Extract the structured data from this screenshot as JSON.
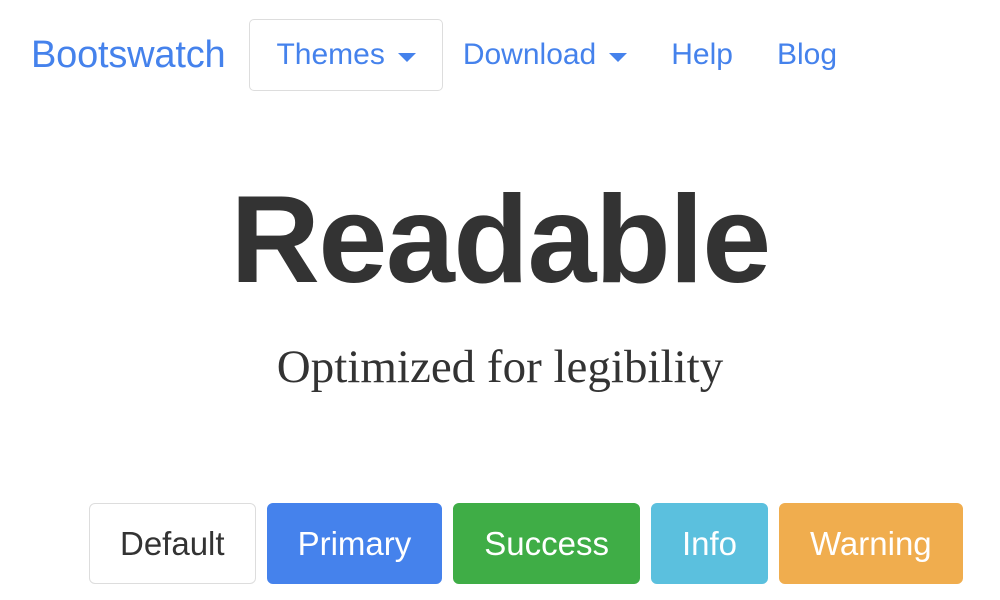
{
  "navbar": {
    "brand": "Bootswatch",
    "items": [
      {
        "label": "Themes",
        "has_caret": true,
        "style": "boxed"
      },
      {
        "label": "Download",
        "has_caret": true,
        "style": "plain"
      },
      {
        "label": "Help",
        "has_caret": false,
        "style": "plain"
      },
      {
        "label": "Blog",
        "has_caret": false,
        "style": "plain"
      }
    ],
    "link_color": "#4582ec",
    "border_color": "#dddddd"
  },
  "hero": {
    "title": "Readable",
    "subtitle": "Optimized for legibility",
    "title_color": "#333333"
  },
  "buttons": [
    {
      "label": "Default",
      "variant": "default",
      "color": "#ffffff",
      "text_color": "#333333"
    },
    {
      "label": "Primary",
      "variant": "primary",
      "color": "#4582ec",
      "text_color": "#ffffff"
    },
    {
      "label": "Success",
      "variant": "success",
      "color": "#3fad46",
      "text_color": "#ffffff"
    },
    {
      "label": "Info",
      "variant": "info",
      "color": "#5bc0de",
      "text_color": "#ffffff"
    },
    {
      "label": "Warning",
      "variant": "warning",
      "color": "#f0ad4e",
      "text_color": "#ffffff"
    }
  ]
}
